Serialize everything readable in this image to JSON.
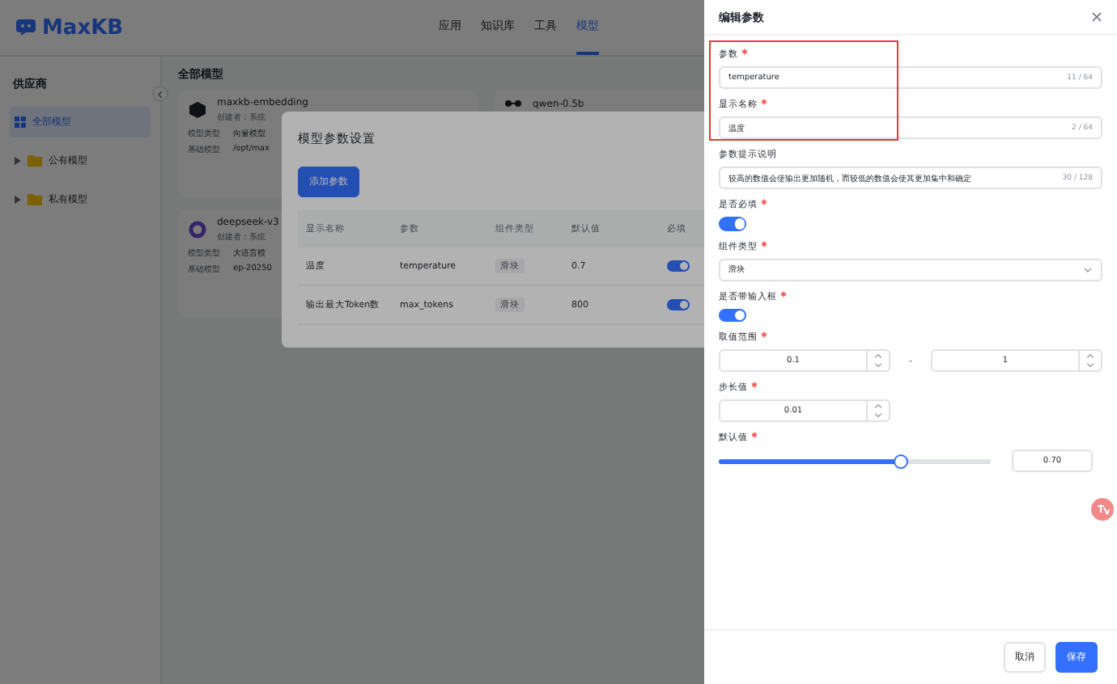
{
  "app": {
    "logo": "MaxKB",
    "nav": [
      {
        "label": "应用",
        "selected": false
      },
      {
        "label": "知识库",
        "selected": false
      },
      {
        "label": "工具",
        "selected": false
      },
      {
        "label": "模型",
        "selected": true
      }
    ]
  },
  "sidebar": {
    "title": "供应商",
    "items": [
      {
        "label": "全部模型",
        "kind": "all",
        "selected": true
      },
      {
        "label": "公有模型",
        "kind": "folder",
        "selected": false
      },
      {
        "label": "私有模型",
        "kind": "folder",
        "selected": false
      }
    ]
  },
  "content": {
    "title": "全部模型",
    "cards": [
      {
        "name": "maxkb-embedding",
        "creator": "创建者：系统",
        "kind": "cube",
        "rows": [
          {
            "label": "模型类型",
            "value": "向量模型"
          },
          {
            "label": "基础模型",
            "value": "/opt/max"
          }
        ]
      },
      {
        "name": "qwen-0.5b",
        "kind": "nodes"
      },
      {
        "name": "deepseek-v3",
        "creator": "创建者：系统",
        "kind": "ring",
        "rows": [
          {
            "label": "模型类型",
            "value": "大语言模"
          },
          {
            "label": "基础模型",
            "value": "ep-20250"
          }
        ]
      }
    ]
  },
  "dialog": {
    "title": "模型参数设置",
    "add_button": "添加参数",
    "columns": [
      "显示名称",
      "参数",
      "组件类型",
      "默认值",
      "必填"
    ],
    "rows": [
      {
        "name": "温度",
        "param": "temperature",
        "type": "滑块",
        "default": "0.7",
        "required": true
      },
      {
        "name": "输出最大Token数",
        "param": "max_tokens",
        "type": "滑块",
        "default": "800",
        "required": true
      }
    ]
  },
  "drawer": {
    "title": "编辑参数",
    "fields": [
      {
        "kind": "text",
        "label": "参数",
        "required": true,
        "value": "temperature",
        "count": "11 / 64"
      },
      {
        "kind": "text",
        "label": "显示名称",
        "required": true,
        "value": "温度",
        "count": "2 / 64"
      },
      {
        "kind": "text",
        "label": "参数提示说明",
        "value": "较高的数值会使输出更加随机，而较低的数值会使其更加集中和确定",
        "count": "30 / 128"
      },
      {
        "kind": "switch",
        "label": "是否必填",
        "required": true,
        "on": true
      },
      {
        "kind": "select",
        "label": "组件类型",
        "required": true,
        "value": "滑块"
      },
      {
        "kind": "switch",
        "label": "是否带输入框",
        "required": true,
        "on": true
      },
      {
        "kind": "range",
        "label": "取值范围",
        "required": true,
        "min": "0.1",
        "separator": "-",
        "max": "1"
      },
      {
        "kind": "number",
        "label": "步长值",
        "required": true,
        "value": "0.01"
      },
      {
        "kind": "slider",
        "label": "默认值",
        "required": true,
        "level": 0.667,
        "value": "0.70"
      }
    ],
    "cancel": "取消",
    "save": "保存"
  }
}
